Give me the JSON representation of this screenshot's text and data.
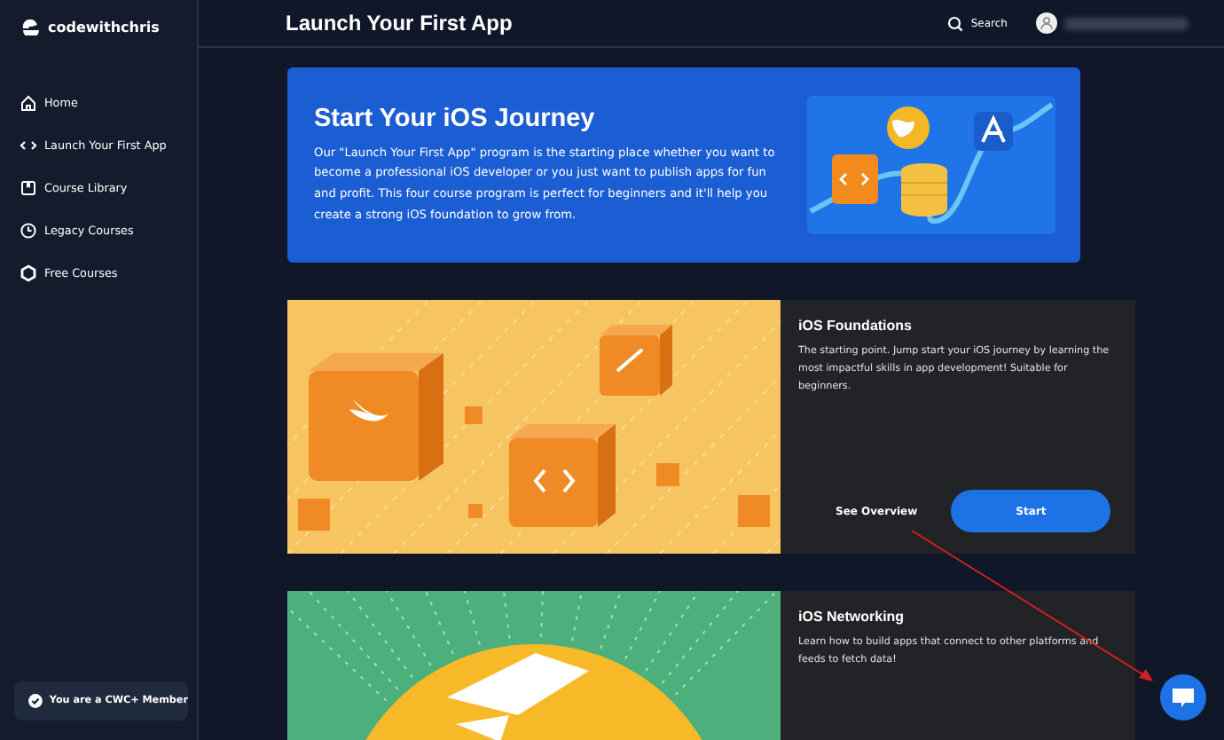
{
  "sidebar": {
    "logo": "codewithchris",
    "items": [
      {
        "label": "Home"
      },
      {
        "label": "Launch Your First App"
      },
      {
        "label": "Course Library"
      },
      {
        "label": "Legacy Courses"
      },
      {
        "label": "Free Courses"
      }
    ],
    "member_badge": "You are a CWC+ Member"
  },
  "header": {
    "title": "Launch Your First App",
    "search": "Search"
  },
  "hero": {
    "title": "Start Your iOS Journey",
    "text": "Our \"Launch Your First App\" program is the starting place whether you want to become a professional iOS developer or you just want to publish apps for fun and profit. This four course program is perfect for beginners and it'll help you create a strong iOS foundation to grow from."
  },
  "courses": [
    {
      "kind": "cubes",
      "title": "iOS Foundations",
      "description": "The starting point. Jump start your iOS journey by learning the most impactful skills in app development! Suitable for beginners.",
      "see_overview": "See Overview",
      "start": "Start"
    },
    {
      "kind": "globe",
      "title": "iOS Networking",
      "description": "Learn how to build apps that connect to other platforms and feeds to fetch data!"
    }
  ]
}
